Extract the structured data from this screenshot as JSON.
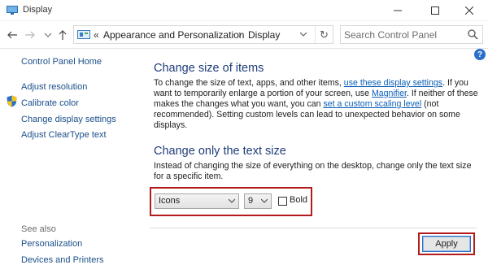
{
  "window": {
    "title": "Display",
    "minimize_glyph": "—",
    "maximize_glyph": "☐",
    "close_glyph": "✕"
  },
  "address_bar": {
    "root_separator": "«",
    "breadcrumbs": [
      "Appearance and Personalization",
      "Display"
    ],
    "separator": "›",
    "refresh_glyph": "↻"
  },
  "search": {
    "placeholder": "Search Control Panel"
  },
  "left_nav": {
    "home": "Control Panel Home",
    "items": [
      "Adjust resolution",
      "Calibrate color",
      "Change display settings",
      "Adjust ClearType text"
    ],
    "see_also_label": "See also",
    "see_also_items": [
      "Personalization",
      "Devices and Printers"
    ]
  },
  "help": {
    "glyph": "?"
  },
  "section_size": {
    "heading": "Change size of items",
    "text_1": "To change the size of text, apps, and other items, ",
    "link_1": "use these display settings",
    "text_2": ". If you want to temporarily enlarge a portion of your screen, use ",
    "link_2": "Magnifier",
    "text_3": ". If neither of these makes the changes what you want, you can ",
    "link_3": "set a custom scaling level",
    "text_4": " (not recommended). Setting custom levels can lead to unexpected behavior on some displays."
  },
  "section_text": {
    "heading": "Change only the text size",
    "description": "Instead of changing the size of everything on the desktop, change only the text size for a specific item.",
    "item_select_value": "Icons",
    "size_select_value": "9",
    "bold_label": "Bold",
    "bold_checked": false
  },
  "buttons": {
    "apply": "Apply"
  },
  "colors": {
    "highlight_frame": "#b31b1b",
    "heading": "#1e3c7a",
    "link": "#0b5fb7",
    "nav_link": "#1a4f8a"
  },
  "icons": {
    "app": "display-icon",
    "back": "arrow-left-icon",
    "forward": "arrow-right-icon",
    "recent": "chevron-down-icon",
    "up": "arrow-up-icon",
    "control_panel": "control-panel-icon",
    "search": "search-icon",
    "shield": "uac-shield-icon",
    "help": "help-icon"
  }
}
